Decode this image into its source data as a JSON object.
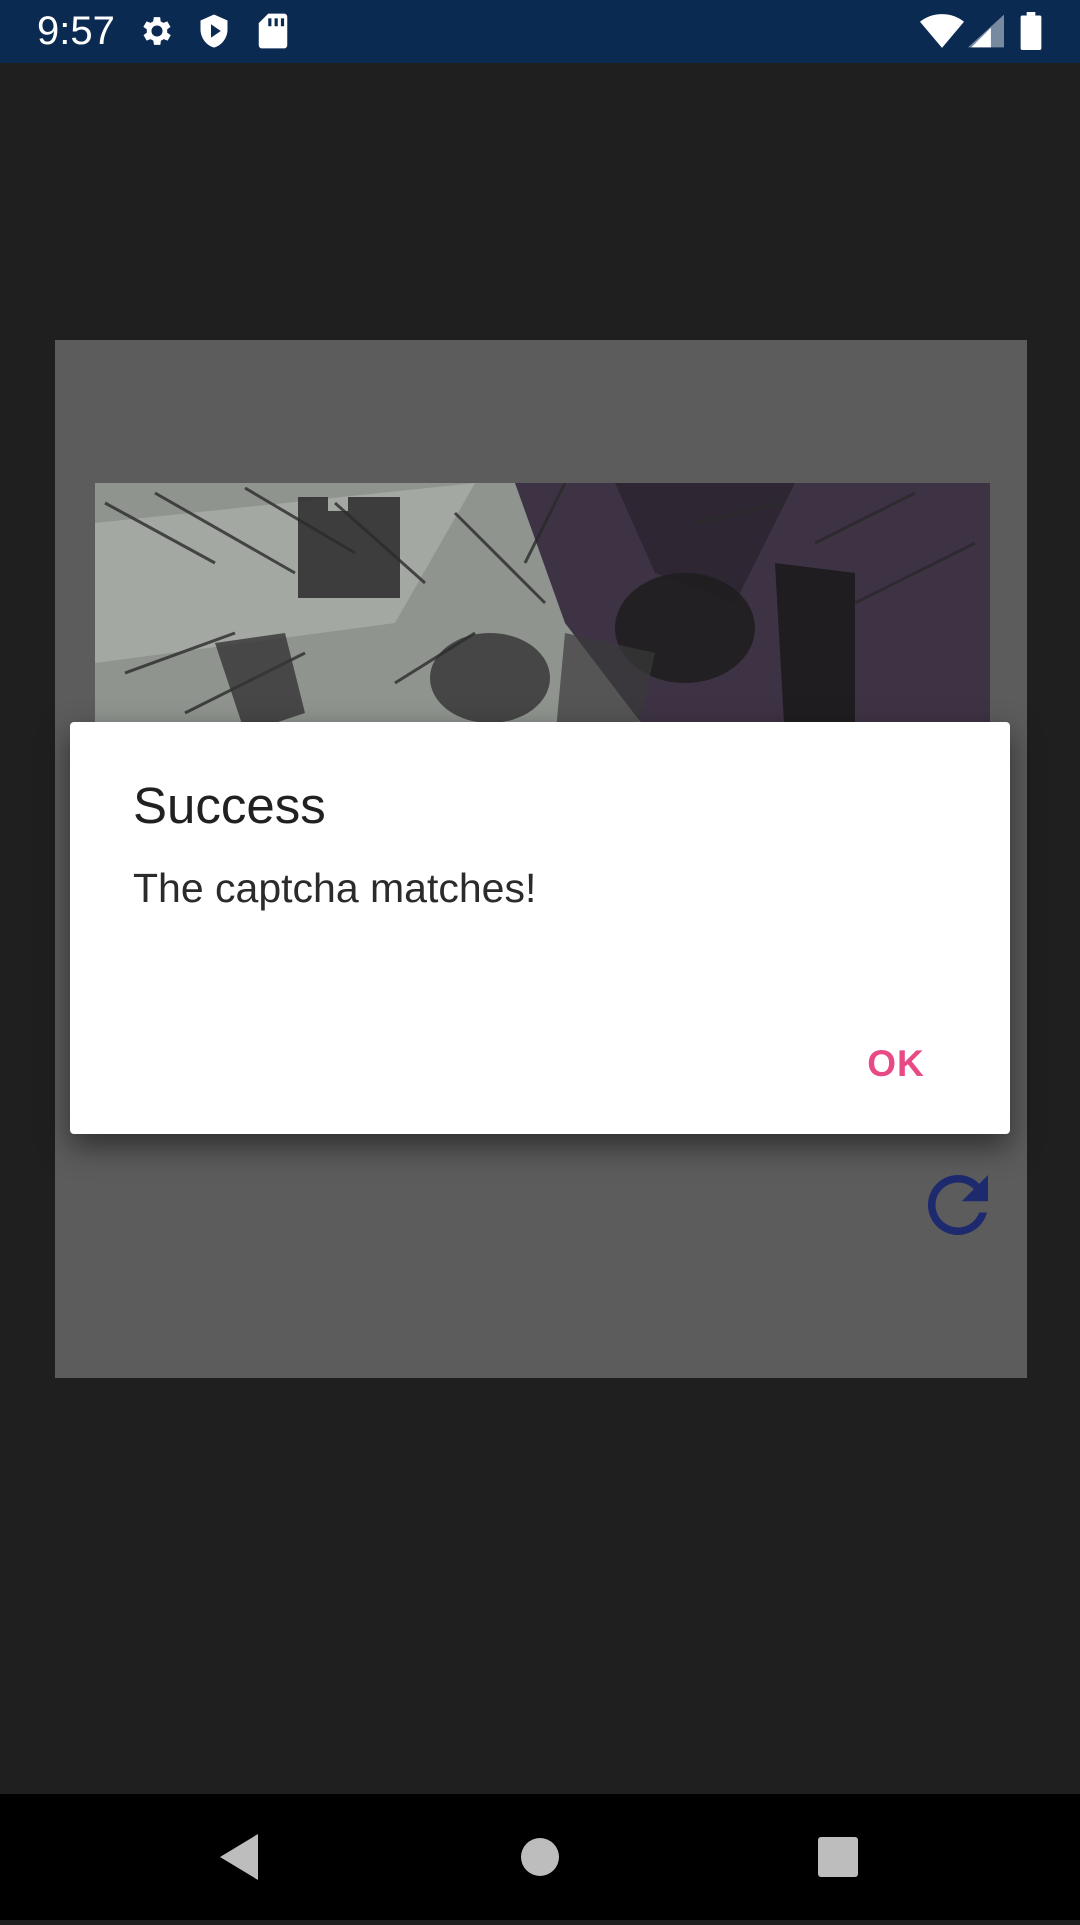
{
  "status_bar": {
    "time": "9:57",
    "left_icons": [
      "settings-icon",
      "shield-play-icon",
      "sd-card-icon"
    ],
    "right_icons": [
      "wifi-icon",
      "cell-signal-icon",
      "battery-icon"
    ],
    "background_color": "#0a2a52"
  },
  "captcha": {
    "image": "sketch-artwork-image",
    "puzzle_piece": "puzzle-piece-slot",
    "refresh_icon": "refresh-icon"
  },
  "dialog": {
    "title": "Success",
    "message": "The captcha matches!",
    "ok_label": "OK",
    "accent_color": "#e84a85"
  },
  "nav_bar": {
    "back_icon": "back-icon",
    "home_icon": "home-icon",
    "recents_icon": "recents-icon"
  }
}
